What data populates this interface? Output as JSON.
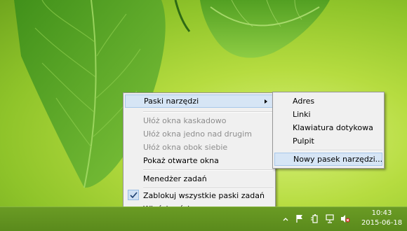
{
  "context_menu": {
    "items": [
      {
        "label": "Paski narzędzi"
      },
      {
        "label": "Ułóż okna kaskadowo"
      },
      {
        "label": "Ułóż okna jedno nad drugim"
      },
      {
        "label": "Ułóż okna obok siebie"
      },
      {
        "label": "Pokaż otwarte okna"
      },
      {
        "label": "Menedżer zadań"
      },
      {
        "label": "Zablokuj wszystkie paski zadań"
      },
      {
        "label": "Właściwości"
      }
    ]
  },
  "submenu": {
    "items": [
      {
        "label": "Adres"
      },
      {
        "label": "Linki"
      },
      {
        "label": "Klawiatura dotykowa"
      },
      {
        "label": "Pulpit"
      },
      {
        "label": "Nowy pasek narzędzi..."
      }
    ]
  },
  "taskbar": {
    "clock_time": "10:43",
    "clock_date": "2015-06-18"
  },
  "colors": {
    "menu_bg": "#f0f0f0",
    "highlight": "#d6e5f5",
    "taskbar": "#5f901f"
  }
}
